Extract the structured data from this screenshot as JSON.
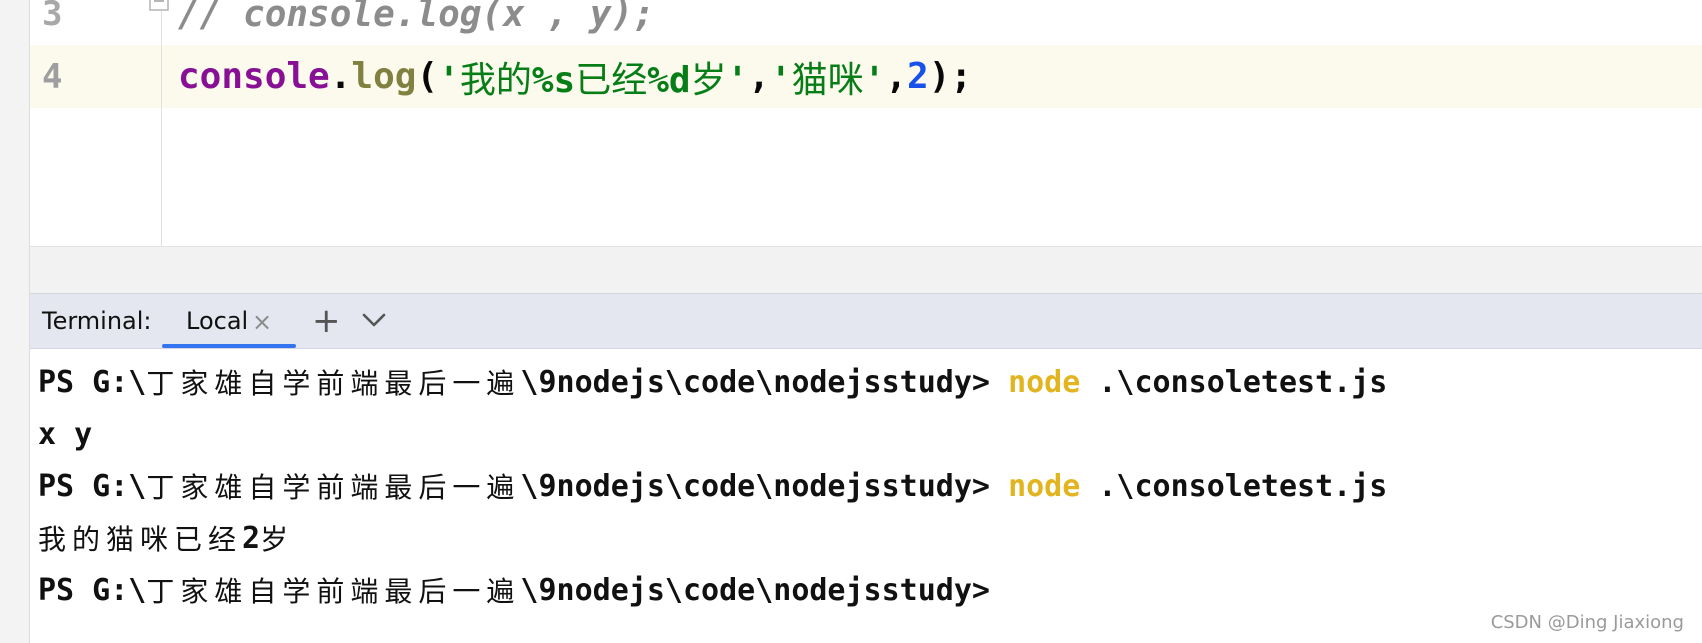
{
  "editor": {
    "line3": {
      "number": "3",
      "code": "// console.log(x , y);"
    },
    "line4": {
      "number": "4",
      "tok_console": "console",
      "tok_dot": ".",
      "tok_log": "log",
      "tok_open": "(",
      "tok_q1": "'",
      "tok_s1": "我的",
      "tok_fmt1": "%s",
      "tok_s2": "已经",
      "tok_fmt2": "%d",
      "tok_s3": "岁",
      "tok_q2": "'",
      "tok_comma1": ",",
      "tok_q3": "'",
      "tok_s4": "猫咪",
      "tok_q4": "'",
      "tok_comma2": ",",
      "tok_num": "2",
      "tok_close": ");"
    }
  },
  "terminal": {
    "title": "Terminal:",
    "tab_label": "Local",
    "tab_close": "×",
    "add": "+",
    "lines": {
      "l1": {
        "prefix": "PS G:\\",
        "cjk": "丁家雄自学前端最后一遍",
        "path": "\\9nodejs\\code\\nodejsstudy> ",
        "cmd": "node",
        "arg": " .\\consoletest.js"
      },
      "l2": {
        "text": "x y"
      },
      "l3": {
        "prefix": "PS G:\\",
        "cjk": "丁家雄自学前端最后一遍",
        "path": "\\9nodejs\\code\\nodejsstudy> ",
        "cmd": "node",
        "arg": " .\\consoletest.js"
      },
      "l4": {
        "cjk1": "我的猫咪已经",
        "num": "2",
        "cjk2": "岁"
      },
      "l5": {
        "prefix": "PS G:\\",
        "cjk": "丁家雄自学前端最后一遍",
        "path": "\\9nodejs\\code\\nodejsstudy>"
      }
    }
  },
  "watermark": "CSDN @Ding Jiaxiong",
  "icons": {
    "fold": "fold-marker-icon",
    "close": "close-icon",
    "add": "plus-icon",
    "chevron": "chevron-down-icon"
  }
}
